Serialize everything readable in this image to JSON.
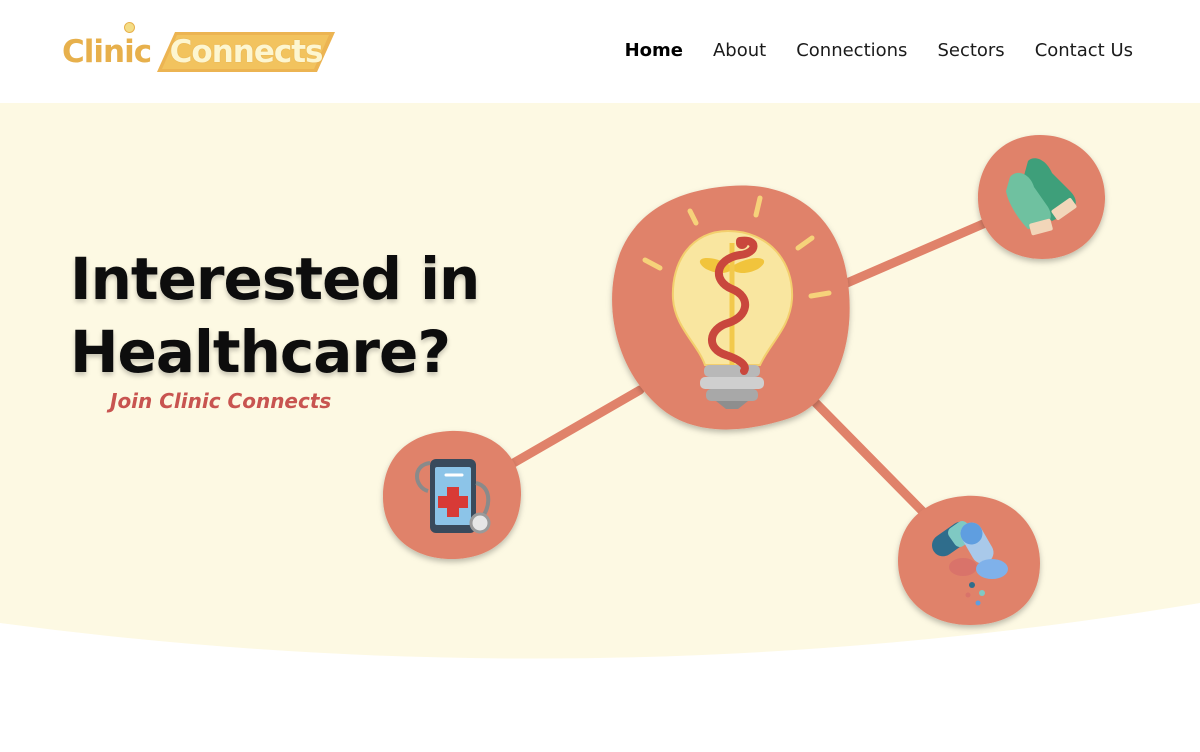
{
  "brand": {
    "name_part1": "Clinic",
    "name_part2": "Connects",
    "colors": {
      "gold": "#e7b04c",
      "cream": "#fdf6d0",
      "coral": "#e0826a"
    }
  },
  "nav": {
    "items": [
      {
        "label": "Home",
        "active": true
      },
      {
        "label": "About",
        "active": false
      },
      {
        "label": "Connections",
        "active": false
      },
      {
        "label": "Sectors",
        "active": false
      },
      {
        "label": "Contact Us",
        "active": false
      }
    ]
  },
  "hero": {
    "headline_line1": "Interested in",
    "headline_line2": "Healthcare?",
    "cta": "Join Clinic Connects",
    "background_color": "#fdf9e3",
    "accent_color": "#c85450"
  },
  "illustration": {
    "nodes": [
      {
        "name": "lightbulb-caduceus-icon"
      },
      {
        "name": "medical-gloves-icon"
      },
      {
        "name": "medical-tablet-stethoscope-icon"
      },
      {
        "name": "pills-capsules-icon"
      }
    ]
  }
}
